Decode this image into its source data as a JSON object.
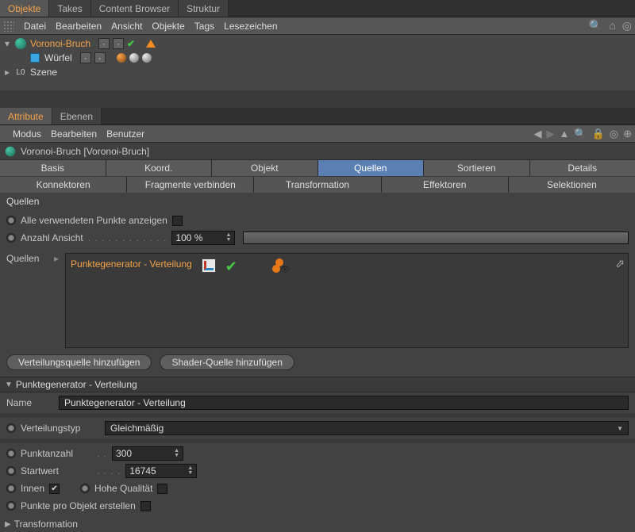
{
  "top_tabs": [
    "Objekte",
    "Takes",
    "Content Browser",
    "Struktur"
  ],
  "top_tab_active": 0,
  "obj_menu": [
    "Datei",
    "Bearbeiten",
    "Ansicht",
    "Objekte",
    "Tags",
    "Lesezeichen"
  ],
  "tree": {
    "items": [
      {
        "label": "Voronoi-Bruch",
        "type": "fracture",
        "selected": true,
        "indent": 0,
        "extras": "fracture"
      },
      {
        "label": "Würfel",
        "type": "cube",
        "selected": false,
        "indent": 1,
        "extras": "phong"
      },
      {
        "label": "Szene",
        "type": "scene",
        "selected": false,
        "indent": 0,
        "extras": "none"
      }
    ]
  },
  "attr_tabs": [
    "Attribute",
    "Ebenen"
  ],
  "attr_tab_active": 0,
  "attr_menu": [
    "Modus",
    "Bearbeiten",
    "Benutzer"
  ],
  "obj_title": "Voronoi-Bruch [Voronoi-Bruch]",
  "tabs_row1": [
    "Basis",
    "Koord.",
    "Objekt",
    "Quellen",
    "Sortieren",
    "Details"
  ],
  "tabs_row1_active": 3,
  "tabs_row2": [
    "Konnektoren",
    "Fragmente verbinden",
    "Transformation",
    "Effektoren",
    "Selektionen"
  ],
  "section_quellen": "Quellen",
  "show_all_points_label": "Alle verwendeten Punkte anzeigen",
  "show_all_points_checked": false,
  "count_view_label": "Anzahl Ansicht",
  "count_view_value": "100 %",
  "sources_label": "Quellen",
  "pointgen_label": "Punktegenerator - Verteilung",
  "btn_add_dist": "Verteilungsquelle hinzufügen",
  "btn_add_shader": "Shader-Quelle hinzufügen",
  "pg_section": "Punktegenerator - Verteilung",
  "pg_name_label": "Name",
  "pg_name_value": "Punktegenerator - Verteilung",
  "dist_type_label": "Verteilungstyp",
  "dist_type_value": "Gleichmäßig",
  "point_count_label": "Punktanzahl",
  "point_count_value": "300",
  "seed_label": "Startwert",
  "seed_value": "16745",
  "inner_label": "Innen",
  "inner_checked": true,
  "hq_label": "Hohe Qualität",
  "hq_checked": false,
  "ppo_label": "Punkte pro Objekt erstellen",
  "ppo_checked": false,
  "transformation_label": "Transformation"
}
